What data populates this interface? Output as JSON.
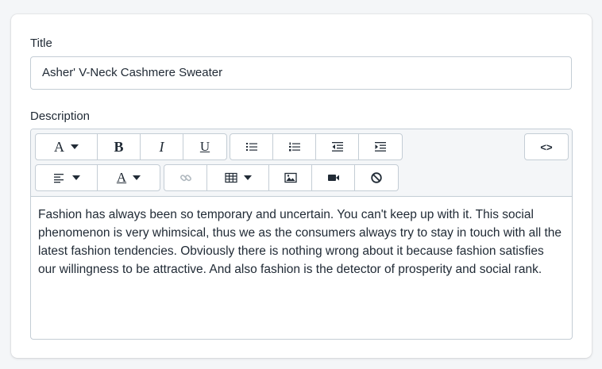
{
  "title_label": "Title",
  "title_value": "Asher' V-Neck Cashmere Sweater",
  "description_label": "Description",
  "toolbar": {
    "font_icon": "font-icon",
    "bold_label": "B",
    "italic_label": "I",
    "underline_label": "U",
    "font_color_label": "A",
    "code_label": "<>",
    "icons": [
      "bullet-list-icon",
      "numbered-list-icon",
      "outdent-icon",
      "indent-icon",
      "align-left-icon",
      "link-icon",
      "table-icon",
      "image-icon",
      "video-icon",
      "clear-format-icon"
    ]
  },
  "description_text": "Fashion has always been so temporary and uncertain. You can't keep up with it. This social phenomenon is very whimsical, thus we as the consumers always try to stay in touch with all the latest fashion tendencies. Obviously there is nothing wrong about it because fashion satisfies our willingness to be attractive. And also fashion is the detector of prosperity and social rank.",
  "colors": {
    "border": "#c4cdd5",
    "toolbar_bg": "#f4f6f8",
    "text": "#212b36",
    "disabled": "#b0b8bf"
  }
}
